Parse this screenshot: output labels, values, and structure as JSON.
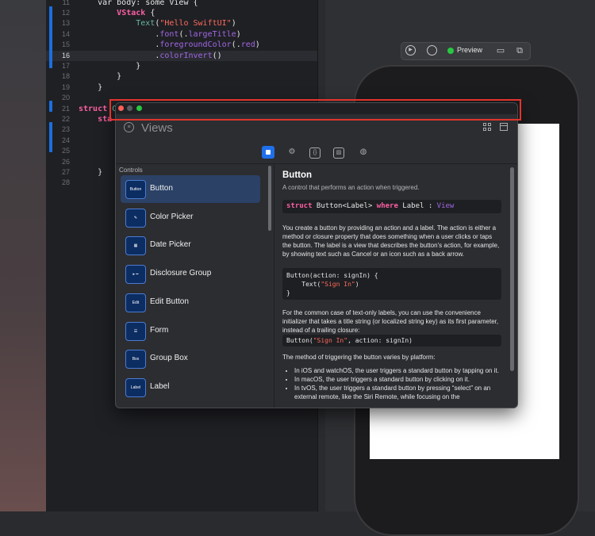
{
  "editor": {
    "lines": [
      {
        "num": "12",
        "html": "        <span class='kw'>VStack</span> {"
      },
      {
        "num": "13",
        "html": "            <span class='fn'>Text</span>(<span class='str'>\"Hello SwiftUI\"</span>)"
      },
      {
        "num": "14",
        "html": "                .<span class='mth'>font</span>(.<span class='mth'>largeTitle</span>)"
      },
      {
        "num": "15",
        "html": "                .<span class='mth'>foregroundColor</span>(.<span class='mth'>red</span>)"
      },
      {
        "num": "16",
        "html": "                .<span class='mth'>colorInvert</span>()",
        "current": true
      },
      {
        "num": "17",
        "html": "            }"
      },
      {
        "num": "18",
        "html": "        }"
      },
      {
        "num": "19",
        "html": "    }"
      },
      {
        "num": "20",
        "html": ""
      },
      {
        "num": "21",
        "html": "<span class='kw'>struct</span> <span class='fn'>C</span>"
      },
      {
        "num": "22",
        "html": "    <span class='kw'>sta</span>"
      },
      {
        "num": "23",
        "html": ""
      },
      {
        "num": "24",
        "html": ""
      },
      {
        "num": "25",
        "html": ""
      },
      {
        "num": "26",
        "html": "        }"
      },
      {
        "num": "27",
        "html": "    }"
      },
      {
        "num": "28",
        "html": ""
      }
    ],
    "top_partial": "    var body: some View {"
  },
  "preview_toolbar": {
    "live_label": "Preview",
    "live_color": "#28c840"
  },
  "library": {
    "search_placeholder": "Views",
    "tab_icons": [
      "views-icon",
      "modifiers-icon",
      "snippets-icon",
      "images-icon",
      "colors-icon"
    ],
    "section_header": "Controls",
    "items": [
      {
        "label": "Button",
        "icon": "Button",
        "selected": true
      },
      {
        "label": "Color Picker",
        "icon": "✎"
      },
      {
        "label": "Date Picker",
        "icon": "▦"
      },
      {
        "label": "Disclosure Group",
        "icon": "▸ ━"
      },
      {
        "label": "Edit Button",
        "icon": "Edit"
      },
      {
        "label": "Form",
        "icon": "☰"
      },
      {
        "label": "Group Box",
        "icon": "Box"
      },
      {
        "label": "Label",
        "icon": "Label"
      }
    ],
    "doc": {
      "title": "Button",
      "subtitle": "A control that performs an action when triggered.",
      "declaration_html": "<span class='k'>struct</span> Button&lt;Label&gt; <span class='k'>where</span> Label : <span class='t'>View</span>",
      "para1": "You create a button by providing an action and a label. The action is either a method or closure property that does something when a user clicks or taps the button. The label is a view that describes the button’s action, for example, by showing text such as Cancel or an icon such as a back arrow.",
      "code1_html": "Button(action: signIn) {\n    Text(<span class='s'>\"Sign In\"</span>)\n}",
      "para2": "For the common case of text-only labels, you can use the convenience initializer that takes a title string (or localized string key) as its first parameter, instead of a trailing closure:",
      "code2_html": "Button(<span class='s'>\"Sign In\"</span>, action: signIn)",
      "para3": "The method of triggering the button varies by platform:",
      "bullets": [
        "In iOS and watchOS, the user triggers a standard button by tapping on it.",
        "In macOS, the user triggers a standard button by clicking on it.",
        "In tvOS, the user triggers a standard button by pressing “select” on an external remote, like the Siri Remote, while focusing on the"
      ]
    }
  },
  "colors": {
    "accent": "#1f6feb",
    "selection_outline": "#e2342c"
  }
}
